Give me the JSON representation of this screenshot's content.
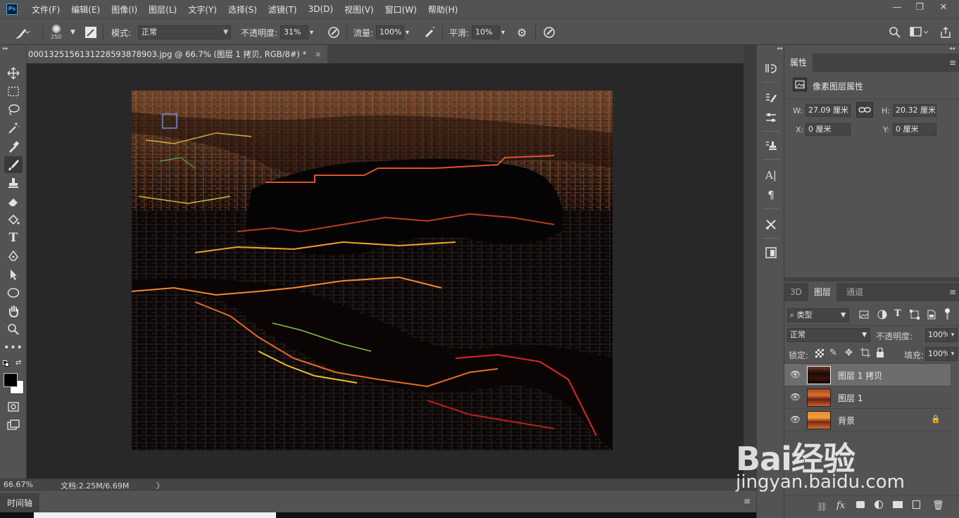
{
  "app": {
    "logo": "Ps"
  },
  "menu": [
    "文件(F)",
    "编辑(E)",
    "图像(I)",
    "图层(L)",
    "文字(Y)",
    "选择(S)",
    "滤镜(T)",
    "3D(D)",
    "视图(V)",
    "窗口(W)",
    "帮助(H)"
  ],
  "window_controls": {
    "minimize": "—",
    "restore": "❐",
    "close": "✕"
  },
  "options": {
    "brush_size": "250",
    "mode_label": "模式:",
    "mode_value": "正常",
    "opacity_label": "不透明度:",
    "opacity_value": "31%",
    "flow_label": "流量:",
    "flow_value": "100%",
    "smoothing_label": "平滑:",
    "smoothing_value": "10%"
  },
  "document": {
    "tab_title": "0001325156131228593878903.jpg @ 66.7% (图层 1 拷贝, RGB/8#) *",
    "close": "×"
  },
  "status": {
    "zoom": "66.67%",
    "doc_info": "文档:2.25M/6.69M",
    "arrow": "〉"
  },
  "timeline": {
    "tab": "时间轴"
  },
  "properties": {
    "tab": "属性",
    "header": "像素图层属性",
    "w_label": "W:",
    "w_value": "27.09 厘米",
    "h_label": "H:",
    "h_value": "20.32 厘米",
    "x_label": "X:",
    "x_value": "0 厘米",
    "y_label": "Y:",
    "y_value": "0 厘米"
  },
  "layers_panel": {
    "tabs": [
      "3D",
      "图层",
      "通道"
    ],
    "filter_kind": "类型",
    "blend_mode": "正常",
    "opacity_label": "不透明度:",
    "opacity_value": "100%",
    "lock_label": "锁定:",
    "fill_label": "填充:",
    "fill_value": "100%",
    "layers": [
      {
        "name": "图层 1 拷贝",
        "selected": true
      },
      {
        "name": "图层 1",
        "selected": false
      },
      {
        "name": "背景",
        "selected": false,
        "locked": true
      }
    ]
  },
  "watermark": {
    "brand": "Bai经验",
    "url": "jingyan.baidu.com"
  },
  "colors": {
    "ui_panel": "#535353",
    "canvas_bg": "#282828",
    "selected_row": "#6d6d6d"
  }
}
